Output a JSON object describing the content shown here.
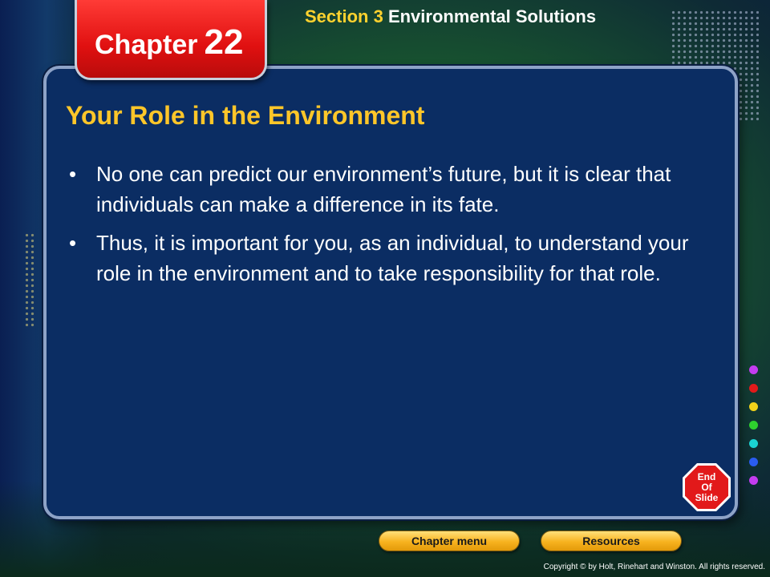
{
  "header": {
    "chapter_word": "Chapter",
    "chapter_number": "22",
    "section_label": "Section 3",
    "section_topic": "Environmental Solutions"
  },
  "slide": {
    "title": "Your Role in the Environment",
    "bullets": [
      "No one can predict our environment’s future, but it is clear that individuals can make a difference in its fate.",
      "Thus, it is important for you, as an individual, to understand your role in the environment and to take responsibility for that role."
    ],
    "bullet_symbol": "•"
  },
  "navigation": {
    "end_of_slide": {
      "line1": "End",
      "line2": "Of",
      "line3": "Slide"
    },
    "chapter_menu_label": "Chapter menu",
    "resources_label": "Resources"
  },
  "footer": {
    "copyright": "Copyright © by Holt, Rinehart and Winston. All rights reserved."
  },
  "decor": {
    "color_dots": [
      "#c43cf0",
      "#e21a1a",
      "#f2d21a",
      "#2ed12e",
      "#1ad4d4",
      "#2a5cf0",
      "#c43cf0"
    ],
    "accent_title": "#ffc629",
    "panel_color": "#0b2d63",
    "tab_color": "#e01010"
  }
}
